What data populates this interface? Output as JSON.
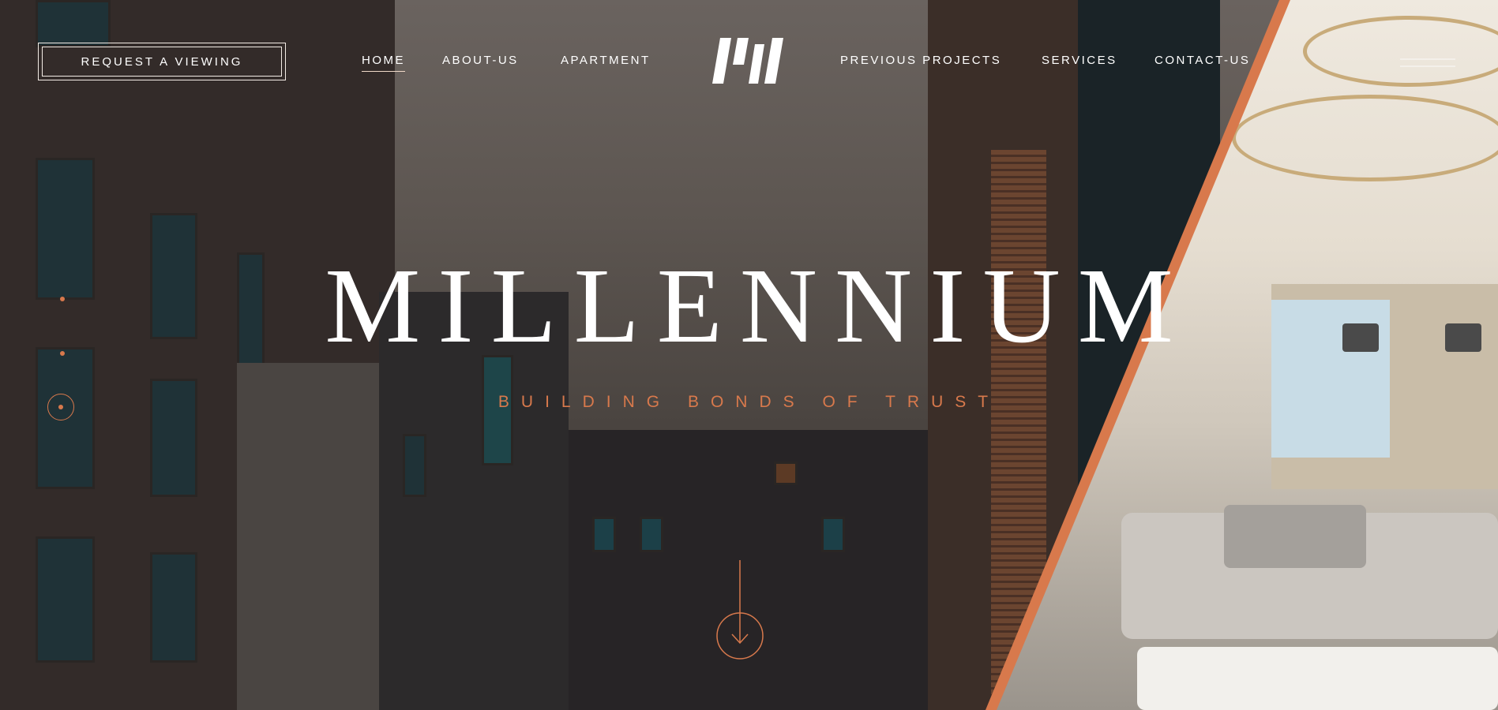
{
  "header": {
    "cta_label": "REQUEST A VIEWING",
    "logo_text": "MI",
    "nav": [
      {
        "label": "HOME",
        "active": true
      },
      {
        "label": "ABOUT-US",
        "active": false
      },
      {
        "label": "APARTMENT",
        "active": false
      },
      {
        "label": "PREVIOUS PROJECTS",
        "active": false
      },
      {
        "label": "SERVICES",
        "active": false
      },
      {
        "label": "CONTACT-US",
        "active": false
      }
    ],
    "menu_icon": "hamburger-icon"
  },
  "hero": {
    "title": "MILLENNIUM",
    "tagline": "BUILDING BONDS OF TRUST",
    "slide_count": 3,
    "active_slide": 3,
    "scroll_icon": "arrow-down-icon"
  },
  "colors": {
    "accent": "#d8794c",
    "text": "#ffffff",
    "overlay": "#5d5651"
  }
}
